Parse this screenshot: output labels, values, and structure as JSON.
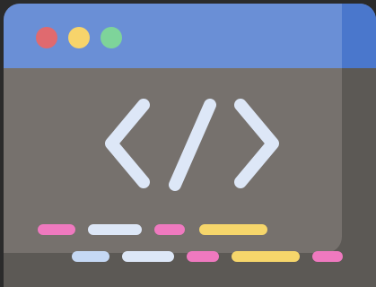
{
  "window": {
    "controls": [
      {
        "name": "close-dot",
        "color": "#e06a6f"
      },
      {
        "name": "minimize-dot",
        "color": "#f7d46b"
      },
      {
        "name": "maximize-dot",
        "color": "#7ed49a"
      }
    ]
  },
  "icon": {
    "glyph": "code-brackets-icon",
    "color": "#dde7f7"
  },
  "code_lines": [
    [
      {
        "color": "#ef79bf"
      },
      {
        "color": "#dde7f7"
      },
      {
        "color": "#ef79bf"
      },
      {
        "color": "#f6d66b"
      }
    ],
    [
      {
        "color": "#c5d8f4"
      },
      {
        "color": "#dde7f7"
      },
      {
        "color": "#ef79bf"
      },
      {
        "color": "#f6d66b"
      },
      {
        "color": "#ef79bf"
      }
    ]
  ],
  "colors": {
    "background": "#2b2b2b",
    "title_bar": "#6a8fd6",
    "title_bar_shade": "#4a77cc",
    "window_body": "#5c5955",
    "content_panel": "#76716d"
  }
}
